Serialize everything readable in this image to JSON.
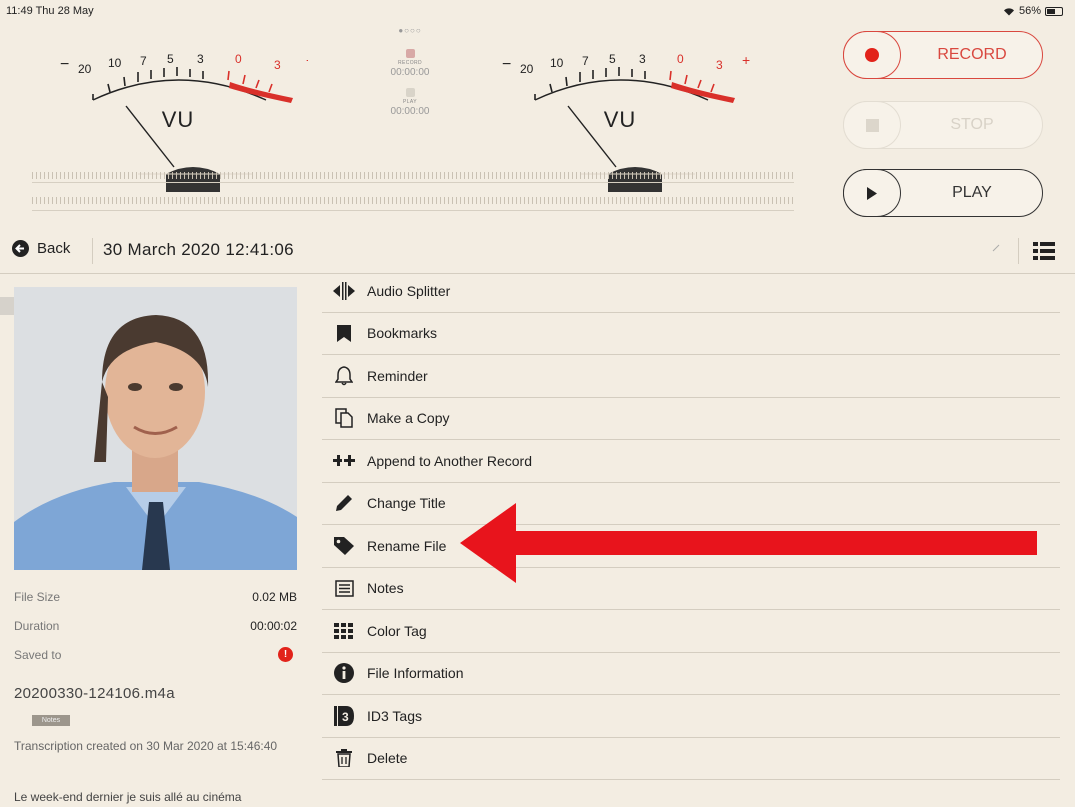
{
  "status": {
    "time": "11:49  Thu 28 May",
    "battery": "56%",
    "battery_level": 0.56
  },
  "meters": {
    "left": {
      "label": "VU",
      "scale": [
        "20",
        "10",
        "7",
        "5",
        "3",
        "0",
        "3"
      ],
      "minus": "−",
      "plus": "+"
    },
    "right": {
      "label": "VU",
      "scale": [
        "20",
        "10",
        "7",
        "5",
        "3",
        "0",
        "3"
      ],
      "minus": "−",
      "plus": "+"
    }
  },
  "center": {
    "page_dots": "●○○○",
    "record_label": "RECORD",
    "record_time": "00:00:00",
    "play_label": "PLAY",
    "play_time": "00:00:00"
  },
  "controls": {
    "record": "RECORD",
    "stop": "STOP",
    "play": "PLAY"
  },
  "nav": {
    "back": "Back",
    "title": "30 March 2020 12:41:06"
  },
  "details": {
    "file_size_label": "File Size",
    "file_size": "0.02 MB",
    "duration_label": "Duration",
    "duration": "00:00:02",
    "saved_to_label": "Saved to",
    "saved_to_icon": "warning-icon",
    "filename": "20200330-124106.m4a",
    "notes_badge": "Notes",
    "transcription": "Transcription created on 30 Mar 2020 at 15:46:40",
    "preview": "Le week-end dernier je suis allé au cinéma"
  },
  "menu": [
    {
      "label": "Audio Splitter",
      "icon": "splitter-icon"
    },
    {
      "label": "Bookmarks",
      "icon": "bookmark-icon"
    },
    {
      "label": "Reminder",
      "icon": "bell-icon"
    },
    {
      "label": "Make a Copy",
      "icon": "copy-icon"
    },
    {
      "label": "Append to Another Record",
      "icon": "append-icon"
    },
    {
      "label": "Change Title",
      "icon": "pencil-icon"
    },
    {
      "label": "Rename File",
      "icon": "tag-icon"
    },
    {
      "label": "Notes",
      "icon": "notes-icon"
    },
    {
      "label": "Color Tag",
      "icon": "color-tag-icon"
    },
    {
      "label": "File Information",
      "icon": "info-icon"
    },
    {
      "label": "ID3 Tags",
      "icon": "id3-icon"
    },
    {
      "label": "Delete",
      "icon": "trash-icon"
    }
  ],
  "colors": {
    "accent_red": "#e2231a",
    "background": "#f3ede2",
    "annotation_arrow": "#e8141c"
  }
}
